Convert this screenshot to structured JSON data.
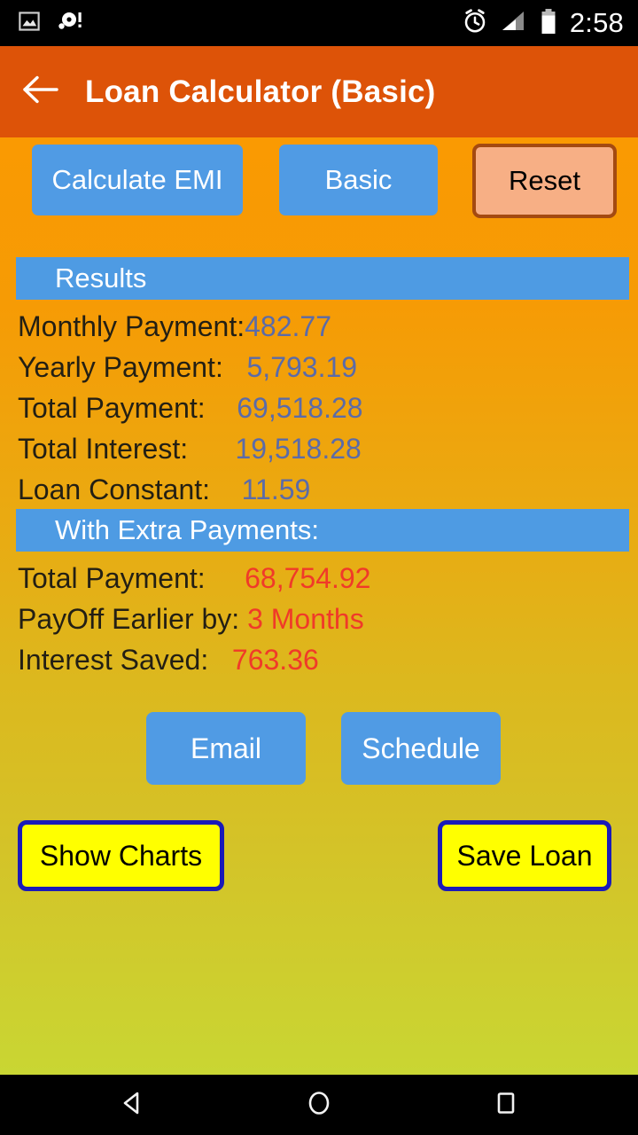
{
  "statusbar": {
    "time": "2:58",
    "icons": [
      "photo-icon",
      "disc-alert-icon",
      "alarm-icon",
      "signal-icon",
      "battery-icon"
    ]
  },
  "appbar": {
    "title": "Loan Calculator (Basic)",
    "back_icon": "back-arrow-icon",
    "background": "#DD5308"
  },
  "toolbar": {
    "calculate_label": "Calculate EMI",
    "mode_label": "Basic",
    "reset_label": "Reset"
  },
  "results": {
    "header": "Results",
    "rows": [
      {
        "label": "Monthly Payment:",
        "gap": "",
        "value": "482.77"
      },
      {
        "label": "Yearly Payment:",
        "gap": "   ",
        "value": "5,793.19"
      },
      {
        "label": "Total Payment:",
        "gap": "    ",
        "value": "69,518.28"
      },
      {
        "label": "Total Interest:",
        "gap": "      ",
        "value": "19,518.28"
      },
      {
        "label": "Loan Constant:",
        "gap": "    ",
        "value": "11.59"
      }
    ]
  },
  "extra_payments": {
    "header": "With Extra Payments:",
    "rows": [
      {
        "label": "Total Payment:",
        "gap": "     ",
        "value": "68,754.92"
      },
      {
        "label": "PayOff Earlier by:",
        "gap": " ",
        "value": "3 Months"
      },
      {
        "label": "Interest Saved:",
        "gap": "   ",
        "value": "763.36"
      }
    ]
  },
  "actions": {
    "email_label": "Email",
    "schedule_label": "Schedule",
    "show_charts_label": "Show Charts",
    "save_loan_label": "Save Loan"
  },
  "navbar": {
    "back": "nav-back-icon",
    "home": "nav-home-icon",
    "recents": "nav-recents-icon"
  },
  "colors": {
    "accent_blue": "#4E9BE3",
    "value_blue": "#5B6BA8",
    "value_red": "#F03A29",
    "appbar_orange": "#DD5308",
    "yellow": "#FFFF00",
    "outline_blue": "#1A1AB8"
  }
}
